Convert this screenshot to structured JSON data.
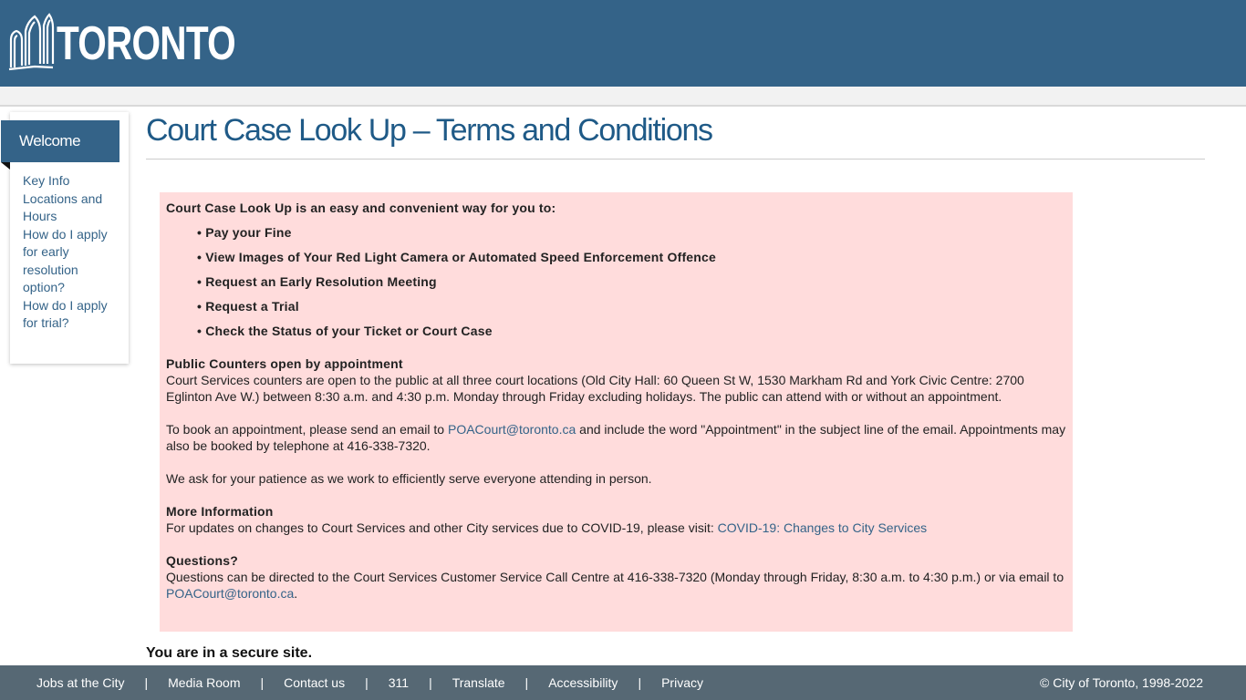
{
  "header": {
    "logo_text": "TORONTO",
    "logo_icon": "city-hall-icon"
  },
  "sidebar": {
    "heading": "Welcome",
    "items": [
      {
        "label": "Key Info"
      },
      {
        "label": "Locations and Hours"
      },
      {
        "label": "How do I apply for early resolution option?"
      },
      {
        "label": "How do I apply for trial?"
      }
    ]
  },
  "main": {
    "title": "Court Case Look Up – Terms and Conditions",
    "notice": {
      "intro": "Court Case Look Up is an easy and convenient way for you to:",
      "bullets": [
        "Pay your Fine",
        "View Images of Your Red Light Camera or Automated Speed Enforcement Offence",
        "Request an Early Resolution Meeting",
        "Request a Trial",
        "Check the Status of your Ticket or Court Case"
      ],
      "counters_heading": "Public Counters open by appointment",
      "counters_text": "Court Services counters are open to the public at all three court locations (Old City Hall: 60 Queen St W, 1530 Markham Rd and York Civic Centre: 2700 Eglinton Ave W.) between 8:30 a.m. and 4:30 p.m. Monday through Friday excluding holidays. The public can attend with or without an appointment.",
      "booking_text_before": "To book an appointment, please send an email to ",
      "booking_email": "POACourt@toronto.ca",
      "booking_text_after": " and include the word \"Appointment\" in the subject line of the email. Appointments may also be booked by telephone at 416-338-7320.",
      "patience_text": "We ask for your patience as we work to efficiently serve everyone attending in person.",
      "more_heading": "More Information",
      "more_text": "For updates on changes to Court Services and other City services due to COVID-19, please visit: ",
      "more_link": "COVID-19: Changes to City Services",
      "questions_heading": "Questions?",
      "questions_text": "Questions can be directed to the Court Services Customer Service Call Centre at 416-338-7320 (Monday through Friday, 8:30 a.m. to 4:30 p.m.) or via email to ",
      "questions_email": "POACourt@toronto.ca",
      "questions_end": "."
    },
    "secure_text": "You are in a secure site."
  },
  "footer": {
    "links": [
      "Jobs at the City",
      "Media Room",
      "Contact us",
      "311",
      "Translate",
      "Accessibility",
      "Privacy"
    ],
    "separator": "|",
    "copyright": "© City of Toronto, 1998-2022"
  },
  "colors": {
    "brand": "#346388",
    "notice_bg": "#ffdcdc",
    "footer_bg": "#566874",
    "link": "#346388"
  }
}
